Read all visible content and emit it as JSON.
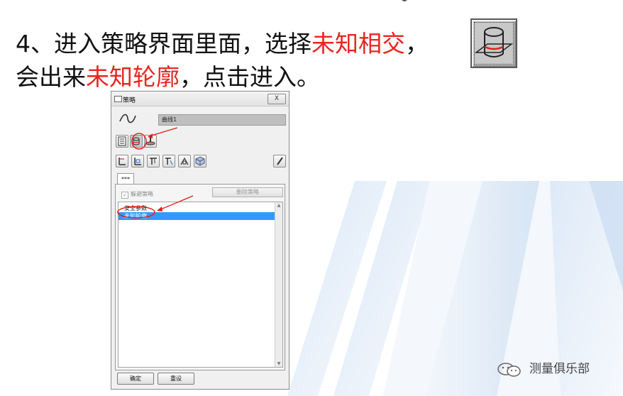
{
  "instruction": {
    "line1_black_a": "4、进入策略界面里面，选择",
    "line1_red": "未知相交",
    "line1_black_b": "，",
    "line2_black_a": "会出来",
    "line2_red": "未知轮廓",
    "line2_black_b": "，点击进入。"
  },
  "colors": {
    "text_black": "#111111",
    "text_red": "#e8251f",
    "selection": "#3399ff",
    "annotation_red": "#e0201a"
  },
  "dialog": {
    "title": "策略",
    "close_label": "X",
    "curve_name": "曲线1",
    "tab_label": "***",
    "bypass_label": "躲避策略",
    "delete_label": "删除策略",
    "list_items": [
      "安全参数",
      "未知轮廓"
    ],
    "selected_index": 1,
    "ok_label": "确定",
    "reset_label": "重设"
  },
  "watermark": {
    "text": "测量俱乐部"
  }
}
